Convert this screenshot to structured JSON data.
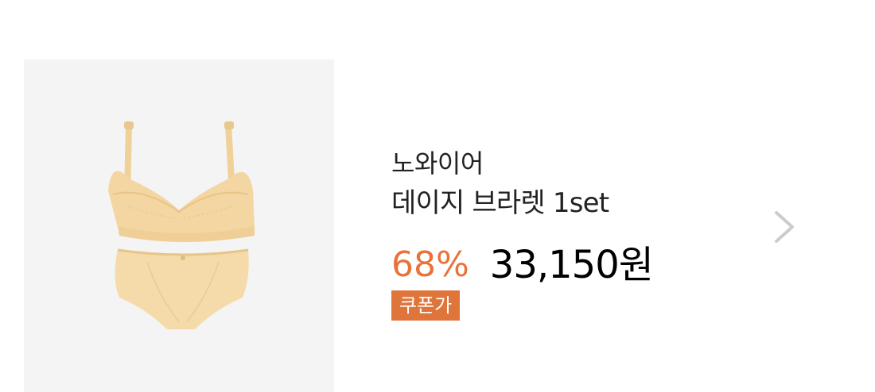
{
  "product": {
    "image_icon": "lingerie-set-image",
    "brand": "노와이어",
    "name": "데이지 브라렛 1set",
    "discount_rate": "68%",
    "price": "33,150원",
    "coupon_label": "쿠폰가",
    "chevron_icon": "chevron-right-icon"
  },
  "colors": {
    "accent": "#e8733a",
    "coupon_bg": "#e0753b",
    "text": "#222222",
    "image_bg": "#f4f4f4",
    "garment": "#f3d6a2",
    "chevron": "#cccccc"
  }
}
